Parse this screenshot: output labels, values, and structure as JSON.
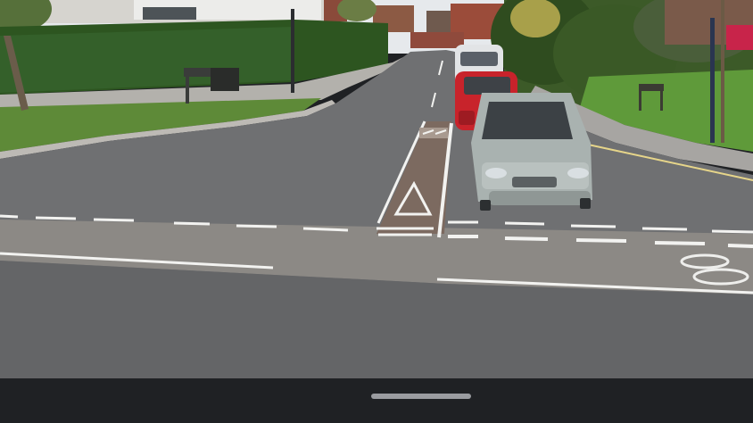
{
  "scene": {
    "type": "street-view-photo",
    "description_name": "residential-road-junction",
    "colors": {
      "sky": "#e8ebee",
      "asphalt": "#6e6f71",
      "near_road": "#646567",
      "cycle_strip": "#8d8a86",
      "grass": "#5f8c3a",
      "hedge": "#2f5a22",
      "pavement": "#a9a7a3",
      "car_silver": "#aab2b0",
      "car_red": "#c8232b",
      "car_white": "#e2e4e6",
      "markings": "#f3f3f1"
    }
  },
  "system_nav": {
    "background": "#1f2124",
    "home_indicator": "#9a9ca0"
  }
}
